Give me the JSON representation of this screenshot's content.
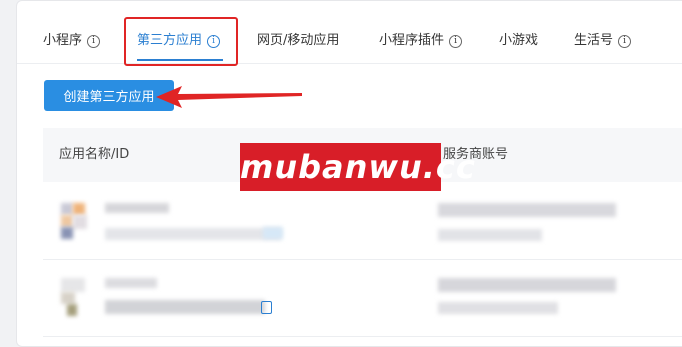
{
  "tabs": [
    {
      "label": "小程序",
      "has_info": true
    },
    {
      "label": "第三方应用",
      "has_info": true
    },
    {
      "label": "网页/移动应用",
      "has_info": false
    },
    {
      "label": "小程序插件",
      "has_info": true
    },
    {
      "label": "小游戏",
      "has_info": false
    },
    {
      "label": "生活号",
      "has_info": true
    }
  ],
  "active_tab": "第三方应用",
  "create_button": {
    "label": "创建第三方应用"
  },
  "table": {
    "columns": [
      "应用名称/ID",
      "服务商账号"
    ],
    "rows": [
      {
        "name": "",
        "id": "",
        "account": ""
      },
      {
        "name": "",
        "id": "",
        "account": ""
      }
    ]
  },
  "watermark": {
    "text": "mubanwu.cc"
  },
  "colors": {
    "accent": "#2b7fd1",
    "button": "#2a8ee2",
    "annotation_red": "#e02525",
    "watermark_bg": "#d81e28"
  },
  "icons": {
    "info": "info-circle-icon",
    "copy": "copy-icon",
    "arrow": "red-arrow-annotation"
  }
}
